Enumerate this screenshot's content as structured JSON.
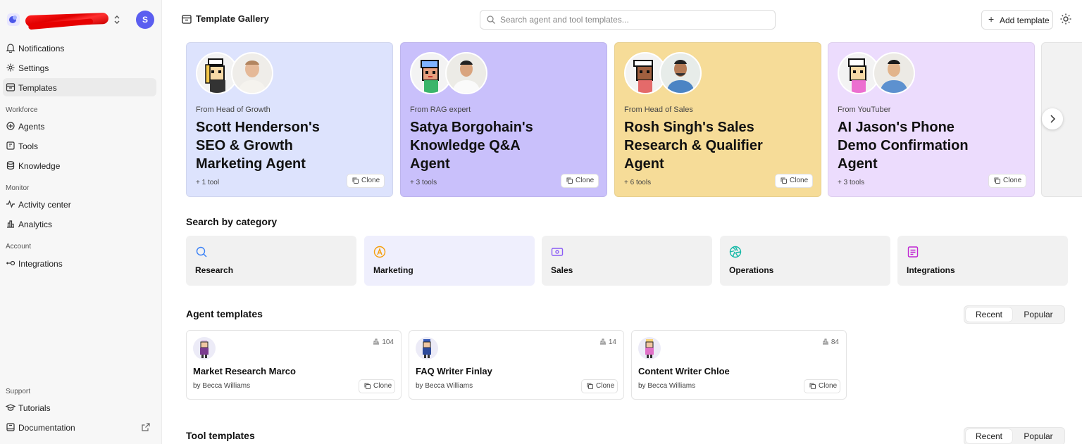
{
  "workspace": {
    "avatar_letter": "S"
  },
  "sidebar": {
    "top_items": [
      {
        "label": "Notifications",
        "icon": "bell-icon"
      },
      {
        "label": "Settings",
        "icon": "gear-icon"
      },
      {
        "label": "Templates",
        "icon": "template-icon",
        "active": true
      }
    ],
    "sections": [
      {
        "label": "Workforce",
        "items": [
          {
            "label": "Agents",
            "icon": "agents-icon"
          },
          {
            "label": "Tools",
            "icon": "tools-icon"
          },
          {
            "label": "Knowledge",
            "icon": "database-icon"
          }
        ]
      },
      {
        "label": "Monitor",
        "items": [
          {
            "label": "Activity center",
            "icon": "activity-icon"
          },
          {
            "label": "Analytics",
            "icon": "analytics-icon"
          }
        ]
      },
      {
        "label": "Account",
        "items": [
          {
            "label": "Integrations",
            "icon": "integrations-icon"
          }
        ]
      }
    ],
    "support": {
      "label": "Support",
      "items": [
        {
          "label": "Tutorials",
          "icon": "graduation-cap-icon"
        },
        {
          "label": "Documentation",
          "icon": "book-icon"
        }
      ]
    }
  },
  "header": {
    "title": "Template Gallery",
    "search_placeholder": "Search agent and tool templates...",
    "add_label": "Add template"
  },
  "featured": [
    {
      "from": "From Head of Growth",
      "name": "Scott Henderson's SEO & Growth Marketing Agent",
      "tools": "+ 1 tool",
      "clone": "Clone",
      "bg": "#dde3fd"
    },
    {
      "from": "From RAG expert",
      "name": "Satya Borgohain's Knowledge Q&A Agent",
      "tools": "+ 3 tools",
      "clone": "Clone",
      "bg": "#c9c0fb"
    },
    {
      "from": "From Head of Sales",
      "name": "Rosh Singh's Sales Research & Qualifier Agent",
      "tools": "+ 6 tools",
      "clone": "Clone",
      "bg": "#f6dc98"
    },
    {
      "from": "From YouTuber",
      "name": "AI Jason's Phone Demo Confirmation Agent",
      "tools": "+ 3 tools",
      "clone": "Clone",
      "bg": "#ecdcfd"
    }
  ],
  "categories_title": "Search by category",
  "categories": [
    {
      "label": "Research",
      "icon": "search-icon",
      "color": "#3b82f6"
    },
    {
      "label": "Marketing",
      "icon": "megaphone-icon",
      "color": "#f59e0b"
    },
    {
      "label": "Sales",
      "icon": "money-icon",
      "color": "#8b5cf6"
    },
    {
      "label": "Operations",
      "icon": "aperture-icon",
      "color": "#14b8a6"
    },
    {
      "label": "Integrations",
      "icon": "document-icon",
      "color": "#c026d3"
    }
  ],
  "agent_templates": {
    "title": "Agent templates",
    "tabs": [
      "Recent",
      "Popular"
    ],
    "items": [
      {
        "name": "Market Research Marco",
        "by": "by Becca Williams",
        "count": "104",
        "clone": "Clone"
      },
      {
        "name": "FAQ Writer Finlay",
        "by": "by Becca Williams",
        "count": "14",
        "clone": "Clone"
      },
      {
        "name": "Content Writer Chloe",
        "by": "by Becca Williams",
        "count": "84",
        "clone": "Clone"
      }
    ]
  },
  "tool_templates": {
    "title": "Tool templates",
    "tabs": [
      "Recent",
      "Popular"
    ]
  }
}
